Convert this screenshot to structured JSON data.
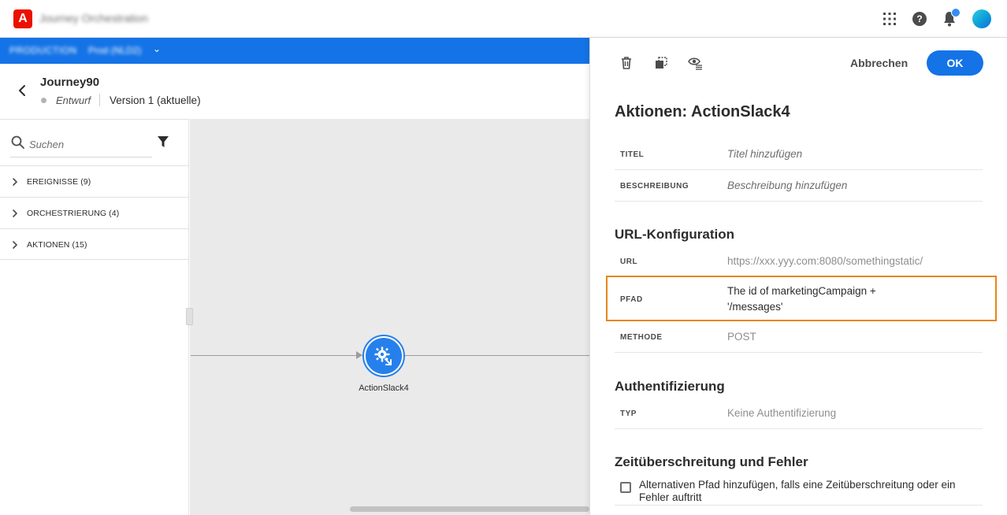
{
  "topbar": {
    "logo_text": "A",
    "app_title": "Journey Orchestration",
    "icons": [
      "apps-icon",
      "help-icon",
      "bell-icon",
      "avatar"
    ],
    "help_glyph": "?"
  },
  "orgbar": {
    "org_name": "PRODUCTION",
    "sandbox_name": "Prod (NLD2)",
    "chevron": "⌄"
  },
  "journey": {
    "name": "Journey90",
    "status": "Entwurf",
    "version": "Version 1 (aktuelle)"
  },
  "palette": {
    "search_placeholder": "Suchen",
    "categories": [
      {
        "label": "EREIGNISSE (9)"
      },
      {
        "label": "ORCHESTRIERUNG (4)"
      },
      {
        "label": "AKTIONEN (15)"
      }
    ]
  },
  "canvas": {
    "node_label": "ActionSlack4"
  },
  "panel": {
    "cancel_label": "Abbrechen",
    "ok_label": "OK",
    "title": "Aktionen: ActionSlack4",
    "fields": {
      "titel": {
        "label": "TITEL",
        "value": "Titel hinzufügen"
      },
      "beschreibung": {
        "label": "BESCHREIBUNG",
        "value": "Beschreibung hinzufügen"
      }
    },
    "url_section": {
      "title": "URL-Konfiguration",
      "url": {
        "label": "URL",
        "value": "https://xxx.yyy.com:8080/somethingstatic/"
      },
      "pfad": {
        "label": "PFAD",
        "line1": "The id of marketingCampaign +",
        "line2": "'/messages'"
      },
      "methode": {
        "label": "METHODE",
        "value": "POST"
      }
    },
    "auth_section": {
      "title": "Authentifizierung",
      "typ": {
        "label": "TYP",
        "value": "Keine Authentifizierung"
      }
    },
    "timeout_section": {
      "title": "Zeitüberschreitung und Fehler",
      "checkbox_label": "Alternativen Pfad hinzufügen, falls eine Zeitüberschreitung oder ein Fehler auftritt",
      "checked": false
    }
  },
  "colors": {
    "brand_blue": "#1473e6",
    "highlight_orange": "#e68619",
    "adobe_red": "#eb1000"
  }
}
